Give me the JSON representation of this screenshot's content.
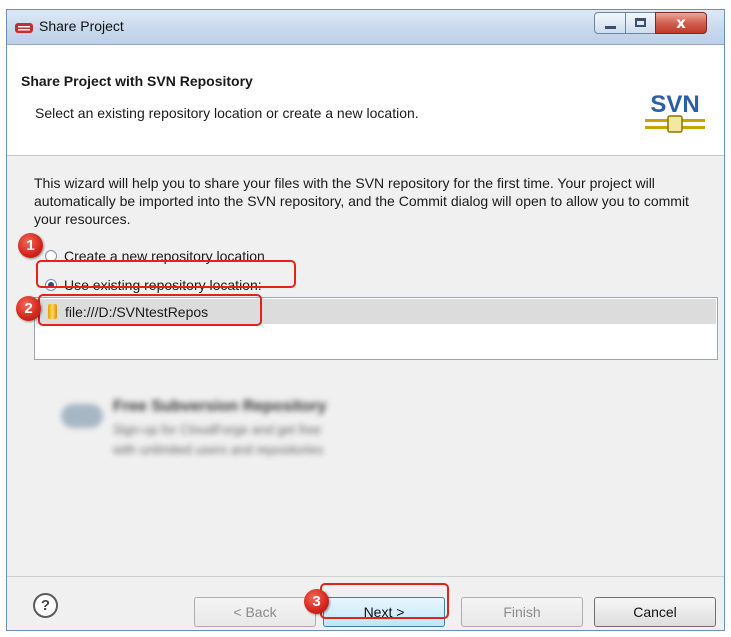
{
  "window": {
    "title": "Share Project",
    "close_glyph": "x"
  },
  "header": {
    "title": "Share Project with SVN Repository",
    "description": "Select an existing repository location or create a new location.",
    "logo_text": "SVN"
  },
  "intro_text": "This wizard will help you to share your files with the SVN repository for the first time. Your project will automatically be imported into the SVN repository, and the Commit dialog will open to allow you to commit your resources.",
  "options": {
    "create_new": {
      "label": "Create a new repository location",
      "checked": false
    },
    "use_existing": {
      "label": "Use existing repository location:",
      "checked": true
    }
  },
  "repositories": [
    {
      "url": "file:///D:/SVNtestRepos",
      "selected": true
    }
  ],
  "promo": {
    "title": "Free Subversion Repository",
    "line1": "Sign-up for CloudForge and get free",
    "line2": "with unlimited users and repositories"
  },
  "buttons": {
    "help": "?",
    "back": "< Back",
    "next": "Next >",
    "finish": "Finish",
    "cancel": "Cancel"
  },
  "callouts": [
    "1",
    "2",
    "3"
  ],
  "colors": {
    "callout_red": "#e2231a",
    "title_gradient_top": "#dfe9f5",
    "primary_button": "#bee6fd"
  }
}
